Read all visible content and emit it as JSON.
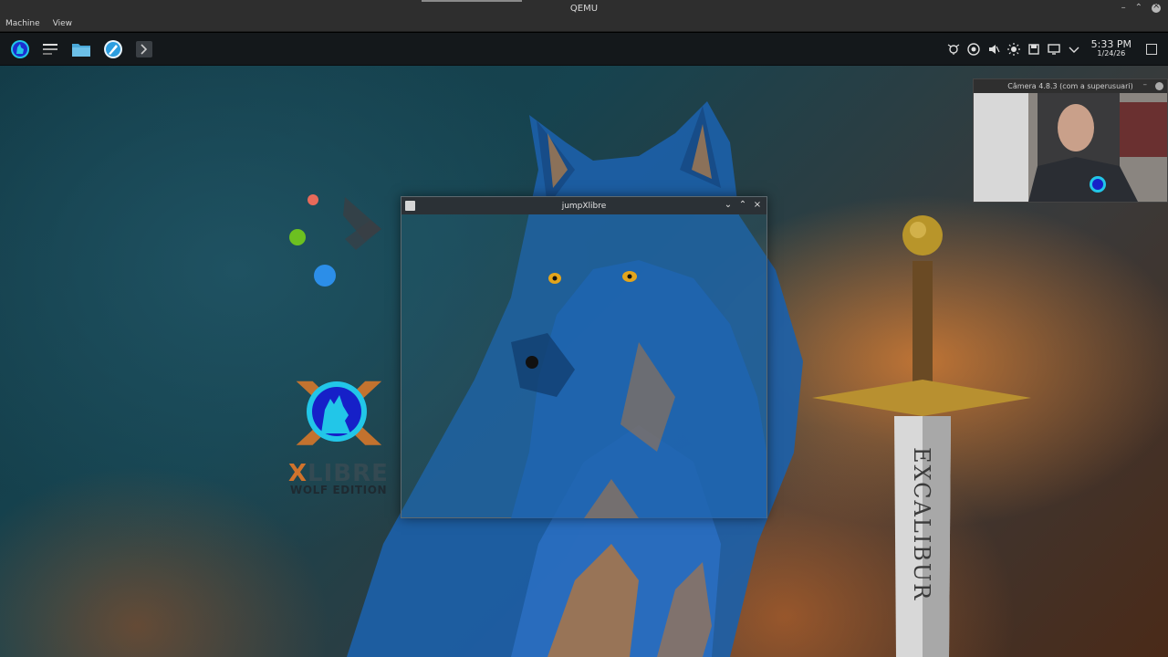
{
  "host": {
    "title": "QEMU",
    "menu": [
      "Machine",
      "View"
    ],
    "window_controls": {
      "minimize": "–",
      "maximize": "⌃"
    }
  },
  "panel": {
    "launchers": [
      "xlibre-menu-icon",
      "task-manager-icon",
      "file-manager-icon",
      "browser-icon",
      "terminal-icon"
    ],
    "tray_icons": [
      "updates-icon",
      "network-icon",
      "volume-muted-icon",
      "brightness-icon",
      "storage-icon",
      "display-icon",
      "chevron-down-icon"
    ],
    "clock": {
      "time": "5:33 PM",
      "date": "1/24/26"
    }
  },
  "wallpaper": {
    "logo_word": "LIBRE",
    "logo_x": "X",
    "edition": "WOLF EDITION",
    "sword_inscription": "EXCALIBUR"
  },
  "app_window": {
    "title": "jumpXlibre",
    "controls": {
      "minimize": "⌄",
      "maximize": "⌃",
      "close": "×"
    }
  },
  "camera_window": {
    "title": "Câmera 4.8.3 (com a superusuari)",
    "minimize": "–"
  },
  "colors": {
    "accent_blue": "#1a8fe0",
    "logo_cyan": "#22c6e8",
    "orange": "#e07a28",
    "dot_red": "#e86a5a",
    "dot_green": "#6cc020",
    "dot_blue": "#2c8ee8"
  }
}
